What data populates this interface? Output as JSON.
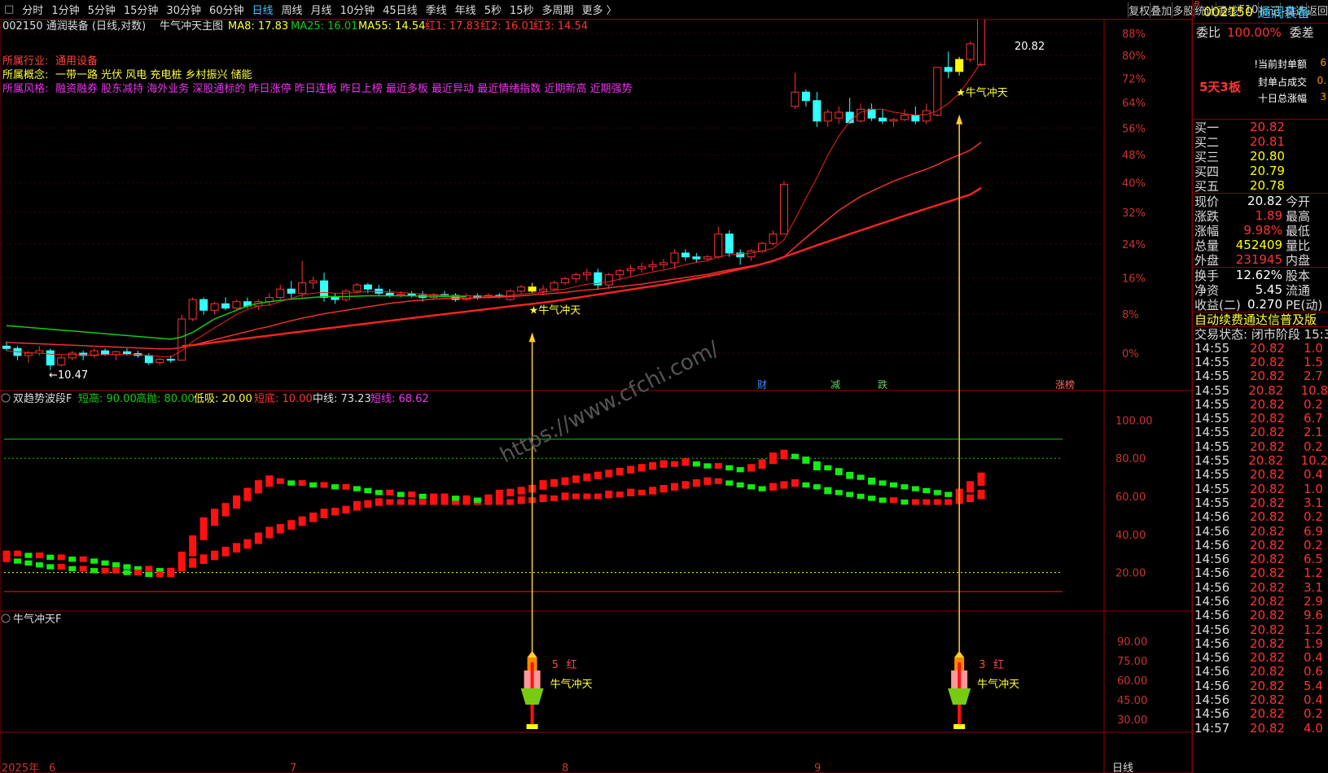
{
  "periods": [
    "分时",
    "1分钟",
    "5分钟",
    "15分钟",
    "30分钟",
    "60分钟",
    "日线",
    "周线",
    "月线",
    "10分钟",
    "45日线",
    "季线",
    "年线",
    "5秒",
    "15秒",
    "多周期",
    "更多 〉"
  ],
  "active_period": "日线",
  "right_tools": [
    "复权",
    "叠加",
    "多股",
    "统计",
    "画线",
    "F10",
    "标记",
    "-自选",
    "返回"
  ],
  "main": {
    "stock": "002150 通润装备 (日线,对数)",
    "title": "牛气冲天主图",
    "ma8": "MA8: 17.83",
    "ma25": "MA25: 16.01",
    "ma55": "MA55: 14.54",
    "h1": "红1: 17.83",
    "h2": "红2: 16.01",
    "h3": "红3: 14.54",
    "industry_label": "所属行业:",
    "industry": "通用设备",
    "concept_label": "所属概念:",
    "concepts": "一带一路 光伏 风电 充电桩 乡村振兴 储能",
    "style_label": "所属风格:",
    "styles": "融资融券 股东减持 海外业务 深股通标的 昨日涨停 昨日连板 昨日上榜 最近多板 最近异动 最近情绪指数 近期新高 近期强势",
    "high_label": "20.82",
    "low_label": "←10.47",
    "signal": "★牛气冲天",
    "pct_ticks": [
      "88%",
      "80%",
      "72%",
      "64%",
      "56%",
      "48%",
      "40%",
      "32%",
      "24%",
      "16%",
      "8%",
      "0%"
    ],
    "markers": [
      "财",
      "减",
      "跌",
      "涨榜"
    ],
    "watermark": "https://www.cfchi.com/"
  },
  "ind": {
    "name": "双趋势波段F",
    "short_high": "短高: 90.00",
    "high_sell": "高抛: 80.00",
    "low_buy": "低吸: 20.00",
    "short_low": "短底: 10.00",
    "mid": "中线: 73.23",
    "short_line": "短线: 68.62",
    "ticks": [
      "100.00",
      "80.00",
      "60.00",
      "40.00",
      "20.00"
    ]
  },
  "bull": {
    "name": "牛气冲天F",
    "ticks": [
      "90.00",
      "75.00",
      "60.00",
      "45.00",
      "30.00"
    ],
    "sig1_count": "5",
    "sig1_color": "红",
    "sig2_count": "3",
    "sig2_color": "红",
    "label": "牛气冲天"
  },
  "xaxis": {
    "year": "2025年",
    "months": [
      "6",
      "7",
      "8",
      "9"
    ],
    "period": "日线"
  },
  "quote": {
    "code": "002150",
    "name": "通润装备",
    "mark": "R",
    "wb_label": "委比",
    "wb": "100.00%",
    "wc_label": "委差",
    "seal_amount": "!当前封单额",
    "seal_ratio": "封单占成交",
    "ten_day": "十日总涨幅",
    "seal_amount_v": "6",
    "seal_ratio_v": "0.",
    "ten_day_v": "3",
    "board": "5天3板",
    "bids": [
      {
        "l": "买一",
        "p": "20.82"
      },
      {
        "l": "买二",
        "p": "20.81"
      },
      {
        "l": "买三",
        "p": "20.80"
      },
      {
        "l": "买四",
        "p": "20.79"
      },
      {
        "l": "买五",
        "p": "20.78"
      }
    ],
    "stats1": [
      {
        "a": "现价",
        "v": "20.82",
        "b": "今开",
        "c": "#fff"
      },
      {
        "a": "涨跌",
        "v": "1.89",
        "b": "最高",
        "c": "#f33"
      },
      {
        "a": "涨幅",
        "v": "9.98%",
        "b": "最低",
        "c": "#f33"
      },
      {
        "a": "总量",
        "v": "452409",
        "b": "量比",
        "c": "#ff0"
      },
      {
        "a": "外盘",
        "v": "231945",
        "b": "内盘",
        "c": "#f33"
      }
    ],
    "stats2": [
      {
        "a": "换手",
        "v": "12.62%",
        "b": "股本"
      },
      {
        "a": "净资",
        "v": "5.45",
        "b": "流通"
      },
      {
        "a": "收益(二)",
        "v": "0.270",
        "b": "PE(动)"
      }
    ],
    "notice": "自动续费通达信普及版",
    "status": "交易状态: 闭市阶段 15:3",
    "ticks": [
      [
        "14:55",
        "20.82",
        "1.0"
      ],
      [
        "14:55",
        "20.82",
        "1.5"
      ],
      [
        "14:55",
        "20.82",
        "2.7"
      ],
      [
        "14:55",
        "20.82",
        "10.8"
      ],
      [
        "14:55",
        "20.82",
        "0.2"
      ],
      [
        "14:55",
        "20.82",
        "6.7"
      ],
      [
        "14:55",
        "20.82",
        "2.1"
      ],
      [
        "14:55",
        "20.82",
        "0.2"
      ],
      [
        "14:55",
        "20.82",
        "10.2"
      ],
      [
        "14:55",
        "20.82",
        "0.4"
      ],
      [
        "14:55",
        "20.82",
        "1.0"
      ],
      [
        "14:55",
        "20.82",
        "3.1"
      ],
      [
        "14:56",
        "20.82",
        "0.2"
      ],
      [
        "14:56",
        "20.82",
        "6.9"
      ],
      [
        "14:56",
        "20.82",
        "0.2"
      ],
      [
        "14:56",
        "20.82",
        "6.5"
      ],
      [
        "14:56",
        "20.82",
        "1.2"
      ],
      [
        "14:56",
        "20.82",
        "3.1"
      ],
      [
        "14:56",
        "20.82",
        "2.9"
      ],
      [
        "14:56",
        "20.82",
        "9.6"
      ],
      [
        "14:56",
        "20.82",
        "1.2"
      ],
      [
        "14:56",
        "20.82",
        "1.9"
      ],
      [
        "14:56",
        "20.82",
        "0.4"
      ],
      [
        "14:56",
        "20.82",
        "0.6"
      ],
      [
        "14:56",
        "20.82",
        "5.4"
      ],
      [
        "14:56",
        "20.82",
        "0.4"
      ],
      [
        "14:56",
        "20.82",
        "0.2"
      ],
      [
        "14:57",
        "20.82",
        "4.0"
      ]
    ]
  },
  "chart_data": {
    "type": "candlestick",
    "dates_note": "",
    "ohlc": [
      [
        10.9,
        11.0,
        10.8,
        10.85
      ],
      [
        10.85,
        10.9,
        10.6,
        10.7
      ],
      [
        10.7,
        10.8,
        10.55,
        10.75
      ],
      [
        10.75,
        10.9,
        10.7,
        10.8
      ],
      [
        10.8,
        10.85,
        10.4,
        10.5
      ],
      [
        10.5,
        10.7,
        10.47,
        10.65
      ],
      [
        10.65,
        10.8,
        10.6,
        10.75
      ],
      [
        10.75,
        10.8,
        10.6,
        10.7
      ],
      [
        10.7,
        10.85,
        10.65,
        10.8
      ],
      [
        10.8,
        10.85,
        10.7,
        10.72
      ],
      [
        10.72,
        10.8,
        10.6,
        10.78
      ],
      [
        10.78,
        10.85,
        10.7,
        10.74
      ],
      [
        10.74,
        10.8,
        10.65,
        10.7
      ],
      [
        10.7,
        10.75,
        10.5,
        10.55
      ],
      [
        10.55,
        10.65,
        10.5,
        10.62
      ],
      [
        10.62,
        10.7,
        10.55,
        10.6
      ],
      [
        10.6,
        11.6,
        10.6,
        11.5
      ],
      [
        11.5,
        12.0,
        11.45,
        11.95
      ],
      [
        11.95,
        12.0,
        11.6,
        11.7
      ],
      [
        11.7,
        11.9,
        11.6,
        11.85
      ],
      [
        11.85,
        12.0,
        11.7,
        11.75
      ],
      [
        11.75,
        11.95,
        11.7,
        11.9
      ],
      [
        11.9,
        12.0,
        11.75,
        11.8
      ],
      [
        11.8,
        11.95,
        11.7,
        11.9
      ],
      [
        11.9,
        12.1,
        11.8,
        12.0
      ],
      [
        12.0,
        12.3,
        11.95,
        12.2
      ],
      [
        12.2,
        12.4,
        12.0,
        12.1
      ],
      [
        12.1,
        12.9,
        12.0,
        12.35
      ],
      [
        12.35,
        12.5,
        12.2,
        12.4
      ],
      [
        12.4,
        12.6,
        11.9,
        12.0
      ],
      [
        12.0,
        12.1,
        11.85,
        11.95
      ],
      [
        11.95,
        12.2,
        11.9,
        12.15
      ],
      [
        12.15,
        12.35,
        12.1,
        12.3
      ],
      [
        12.3,
        12.35,
        12.1,
        12.2
      ],
      [
        12.2,
        12.3,
        12.05,
        12.1
      ],
      [
        12.1,
        12.2,
        12.0,
        12.05
      ],
      [
        12.05,
        12.15,
        12.0,
        12.08
      ],
      [
        12.08,
        12.15,
        12.0,
        12.05
      ],
      [
        12.05,
        12.15,
        11.9,
        12.0
      ],
      [
        12.0,
        12.1,
        11.95,
        12.07
      ],
      [
        12.07,
        12.15,
        12.0,
        12.05
      ],
      [
        12.05,
        12.1,
        11.9,
        11.95
      ],
      [
        11.95,
        12.1,
        11.92,
        12.04
      ],
      [
        12.04,
        12.1,
        11.95,
        12.0
      ],
      [
        12.0,
        12.1,
        11.97,
        12.05
      ],
      [
        12.05,
        12.1,
        11.98,
        12.02
      ],
      [
        11.95,
        12.2,
        11.92,
        12.15
      ],
      [
        12.15,
        12.3,
        12.1,
        12.25
      ],
      [
        12.25,
        12.35,
        12.1,
        12.15
      ],
      [
        12.15,
        12.3,
        12.05,
        12.2
      ],
      [
        12.2,
        12.4,
        12.15,
        12.35
      ],
      [
        12.35,
        12.5,
        12.3,
        12.45
      ],
      [
        12.45,
        12.6,
        12.35,
        12.55
      ],
      [
        12.55,
        12.7,
        12.4,
        12.6
      ],
      [
        12.6,
        12.7,
        12.2,
        12.3
      ],
      [
        12.3,
        12.6,
        12.2,
        12.55
      ],
      [
        12.55,
        12.7,
        12.4,
        12.65
      ],
      [
        12.65,
        12.8,
        12.5,
        12.7
      ],
      [
        12.7,
        12.85,
        12.6,
        12.75
      ],
      [
        12.75,
        12.9,
        12.65,
        12.8
      ],
      [
        12.8,
        12.95,
        12.7,
        12.85
      ],
      [
        12.85,
        13.2,
        12.7,
        13.1
      ],
      [
        13.1,
        13.2,
        12.9,
        13.0
      ],
      [
        13.0,
        13.1,
        12.85,
        12.95
      ],
      [
        12.95,
        13.05,
        12.9,
        13.0
      ],
      [
        13.0,
        13.8,
        12.95,
        13.6
      ],
      [
        13.6,
        13.7,
        13.0,
        13.1
      ],
      [
        13.1,
        13.2,
        12.8,
        13.0
      ],
      [
        13.0,
        13.2,
        12.9,
        13.15
      ],
      [
        13.15,
        13.4,
        13.1,
        13.35
      ],
      [
        13.35,
        13.7,
        13.3,
        13.6
      ],
      [
        13.6,
        15.1,
        13.6,
        15.0
      ],
      [
        17.5,
        18.7,
        17.4,
        18.0
      ],
      [
        18.0,
        18.1,
        17.5,
        17.7
      ],
      [
        17.7,
        18.0,
        16.8,
        17.0
      ],
      [
        17.0,
        17.4,
        16.8,
        17.3
      ],
      [
        17.1,
        17.5,
        16.9,
        17.3
      ],
      [
        17.3,
        17.8,
        16.9,
        16.95
      ],
      [
        17.0,
        17.6,
        16.95,
        17.4
      ],
      [
        17.4,
        17.6,
        17.0,
        17.1
      ],
      [
        17.1,
        17.4,
        16.9,
        17.0
      ],
      [
        17.0,
        17.1,
        16.8,
        17.05
      ],
      [
        17.05,
        17.4,
        17.0,
        17.2
      ],
      [
        17.2,
        17.5,
        16.9,
        17.0
      ],
      [
        17.0,
        17.6,
        16.9,
        17.35
      ],
      [
        17.2,
        18.9,
        17.15,
        18.9
      ],
      [
        18.9,
        19.5,
        18.5,
        18.75
      ],
      [
        18.75,
        19.3,
        18.6,
        19.2
      ],
      [
        19.2,
        19.9,
        19.1,
        19.8
      ],
      [
        19.0,
        20.82,
        18.93,
        20.82
      ]
    ],
    "ma8": [
      10.8,
      10.78,
      10.76,
      10.75,
      10.73,
      10.72,
      10.72,
      10.71,
      10.71,
      10.72,
      10.72,
      10.72,
      10.72,
      10.7,
      10.68,
      10.67,
      10.8,
      11.0,
      11.15,
      11.3,
      11.45,
      11.6,
      11.72,
      11.8,
      11.82,
      11.9,
      11.98,
      12.06,
      12.1,
      12.12,
      12.1,
      12.1,
      12.12,
      12.14,
      12.14,
      12.13,
      12.12,
      12.1,
      12.08,
      12.06,
      12.05,
      12.04,
      12.04,
      12.03,
      12.03,
      12.03,
      12.05,
      12.08,
      12.1,
      12.12,
      12.16,
      12.2,
      12.26,
      12.32,
      12.34,
      12.38,
      12.44,
      12.5,
      12.56,
      12.62,
      12.67,
      12.73,
      12.8,
      12.86,
      12.9,
      13.0,
      13.05,
      13.08,
      13.1,
      13.15,
      13.22,
      13.45,
      14.0,
      14.6,
      15.2,
      15.9,
      16.5,
      17.0,
      17.3,
      17.4,
      17.4,
      17.3,
      17.25,
      17.2,
      17.22,
      17.35,
      17.6,
      17.95,
      18.5,
      19.1
    ],
    "ma25": [
      10.98,
      10.97,
      10.96,
      10.95,
      10.94,
      10.93,
      10.92,
      10.91,
      10.9,
      10.89,
      10.88,
      10.87,
      10.86,
      10.85,
      10.84,
      10.84,
      10.87,
      10.92,
      10.98,
      11.04,
      11.1,
      11.16,
      11.22,
      11.28,
      11.33,
      11.4,
      11.46,
      11.52,
      11.57,
      11.62,
      11.66,
      11.7,
      11.74,
      11.78,
      11.82,
      11.86,
      11.89,
      11.92,
      11.94,
      11.96,
      11.97,
      11.98,
      11.98,
      11.99,
      12.0,
      12.01,
      12.02,
      12.04,
      12.06,
      12.08,
      12.1,
      12.12,
      12.15,
      12.18,
      12.2,
      12.23,
      12.26,
      12.29,
      12.32,
      12.36,
      12.4,
      12.44,
      12.48,
      12.52,
      12.56,
      12.62,
      12.67,
      12.72,
      12.77,
      12.82,
      12.88,
      13.0,
      13.25,
      13.5,
      13.75,
      14.0,
      14.25,
      14.45,
      14.65,
      14.8,
      14.95,
      15.1,
      15.22,
      15.34,
      15.46,
      15.6,
      15.76,
      15.9,
      16.05,
      16.3
    ],
    "ma55": [
      null,
      null,
      null,
      null,
      null,
      null,
      null,
      null,
      null,
      null,
      null,
      null,
      null,
      null,
      null,
      null,
      10.9,
      10.92,
      10.95,
      10.98,
      11.01,
      11.04,
      11.07,
      11.1,
      11.13,
      11.16,
      11.19,
      11.22,
      11.25,
      11.28,
      11.31,
      11.34,
      11.37,
      11.4,
      11.43,
      11.46,
      11.49,
      11.52,
      11.55,
      11.58,
      11.61,
      11.64,
      11.67,
      11.7,
      11.73,
      11.76,
      11.79,
      11.82,
      11.85,
      11.88,
      11.91,
      11.95,
      11.99,
      12.03,
      12.07,
      12.11,
      12.15,
      12.19,
      12.23,
      12.27,
      12.31,
      12.36,
      12.41,
      12.46,
      12.51,
      12.57,
      12.63,
      12.69,
      12.75,
      12.82,
      12.9,
      13.0,
      13.1,
      13.2,
      13.3,
      13.4,
      13.5,
      13.6,
      13.7,
      13.8,
      13.9,
      14.0,
      14.1,
      14.2,
      14.3,
      14.4,
      14.5,
      14.6,
      14.7,
      14.9
    ],
    "ma_green": [
      11.35,
      11.33,
      11.31,
      11.29,
      11.27,
      11.25,
      11.23,
      11.21,
      11.19,
      11.17,
      11.15,
      11.13,
      11.11,
      11.09,
      11.07,
      11.05,
      11.1,
      11.2,
      11.35,
      11.5,
      11.6,
      11.7,
      11.8,
      11.86,
      11.9,
      11.93,
      11.96,
      11.98,
      12.0,
      12.02,
      12.02,
      12.02,
      12.03,
      12.04,
      12.04,
      12.04,
      12.04,
      12.04,
      12.03,
      12.03,
      12.02,
      12.02,
      12.02
    ],
    "ind_short": [
      27,
      26,
      25,
      24,
      23,
      23,
      22,
      22,
      21,
      21,
      21,
      20,
      20,
      19,
      19,
      19,
      26,
      34,
      43,
      49,
      53,
      57,
      61,
      65,
      68,
      68,
      67,
      67,
      66,
      66,
      65,
      65,
      64,
      63,
      62,
      62,
      61,
      61,
      60,
      60,
      60,
      59,
      59,
      58,
      59,
      61,
      62,
      63,
      64,
      66,
      67,
      68,
      69,
      70,
      71,
      72,
      73,
      74,
      75,
      76,
      77,
      77,
      78,
      77,
      76,
      76,
      75,
      74,
      75,
      77,
      80,
      82,
      81,
      79,
      76,
      75,
      73,
      71,
      70,
      68,
      67,
      66,
      65,
      64,
      63,
      62,
      61,
      62,
      65,
      69
    ],
    "ind_mid": [
      30,
      30,
      29,
      29,
      28,
      28,
      27,
      27,
      26,
      25,
      24,
      23,
      22,
      22,
      21,
      21,
      23,
      25,
      27,
      29,
      31,
      33,
      35,
      38,
      41,
      43,
      45,
      47,
      49,
      51,
      52,
      53,
      55,
      56,
      57,
      57,
      57,
      57,
      57,
      57,
      57,
      57,
      57,
      57,
      57,
      57,
      57,
      58,
      58,
      59,
      59,
      60,
      60,
      60,
      60,
      61,
      61,
      62,
      62,
      63,
      64,
      65,
      66,
      67,
      68,
      68,
      67,
      66,
      65,
      64,
      65,
      66,
      67,
      66,
      65,
      63,
      62,
      61,
      60,
      59,
      58,
      58,
      57,
      57,
      57,
      57,
      57,
      58,
      59,
      61
    ]
  }
}
